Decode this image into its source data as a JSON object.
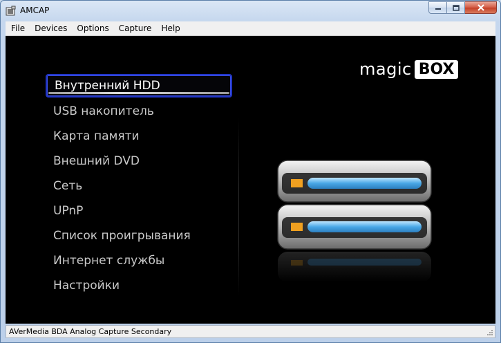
{
  "window": {
    "title": "AMCAP"
  },
  "menu": [
    "File",
    "Devices",
    "Options",
    "Capture",
    "Help"
  ],
  "logo": {
    "magic": "magic",
    "box": "BOX"
  },
  "items": [
    {
      "label": "Внутренний HDD",
      "selected": true
    },
    {
      "label": "USB накопитель"
    },
    {
      "label": "Карта памяти"
    },
    {
      "label": "Внешний DVD"
    },
    {
      "label": "Сеть"
    },
    {
      "label": "UPnP"
    },
    {
      "label": "Список проигрывания"
    },
    {
      "label": "Интернет службы"
    },
    {
      "label": "Настройки"
    }
  ],
  "status": {
    "text": "AVerMedia BDA Analog Capture Secondary"
  },
  "colors": {
    "selection_border": "#2236c8",
    "drive_bar": "#4aa8e6",
    "drive_led": "#f0a020"
  },
  "icons": {
    "app": "camera-app-icon",
    "art": "hard-drive-icon"
  }
}
